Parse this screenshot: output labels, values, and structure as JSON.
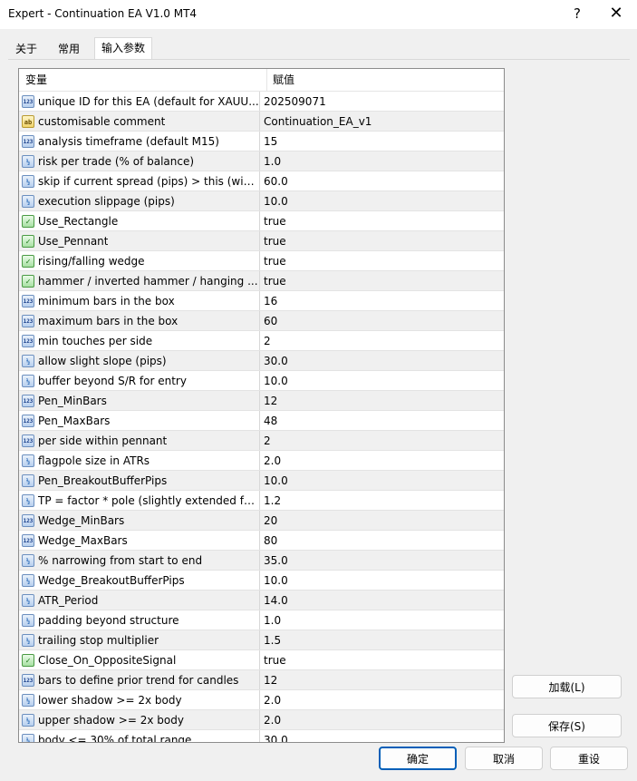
{
  "window": {
    "title": "Expert - Continuation EA V1.0 MT4",
    "help_glyph": "?",
    "close_glyph": "✕"
  },
  "tabs": [
    {
      "label": "关于"
    },
    {
      "label": "常用"
    },
    {
      "label": "输入参数"
    }
  ],
  "table": {
    "col_variable": "变量",
    "col_value": "赋值",
    "rows": [
      {
        "icon": "int",
        "name": "unique ID for this EA (default for XAUU...",
        "value": "202509071"
      },
      {
        "icon": "str",
        "name": "customisable comment",
        "value": "Continuation_EA_v1"
      },
      {
        "icon": "int",
        "name": "analysis timeframe (default M15)",
        "value": "15"
      },
      {
        "icon": "dbl",
        "name": "risk per trade (% of balance)",
        "value": "1.0"
      },
      {
        "icon": "dbl",
        "name": "skip if current spread (pips) > this (wid...",
        "value": "60.0"
      },
      {
        "icon": "dbl",
        "name": "execution slippage (pips)",
        "value": "10.0"
      },
      {
        "icon": "bool",
        "name": "Use_Rectangle",
        "value": "true"
      },
      {
        "icon": "bool",
        "name": "Use_Pennant",
        "value": "true"
      },
      {
        "icon": "bool",
        "name": "rising/falling wedge",
        "value": "true"
      },
      {
        "icon": "bool",
        "name": "hammer / inverted hammer / hanging ...",
        "value": "true"
      },
      {
        "icon": "int",
        "name": "minimum bars in the box",
        "value": "16"
      },
      {
        "icon": "int",
        "name": "maximum bars in the box",
        "value": "60"
      },
      {
        "icon": "int",
        "name": "min touches per side",
        "value": "2"
      },
      {
        "icon": "dbl",
        "name": "allow slight slope (pips)",
        "value": "30.0"
      },
      {
        "icon": "dbl",
        "name": "buffer beyond S/R for entry",
        "value": "10.0"
      },
      {
        "icon": "int",
        "name": "Pen_MinBars",
        "value": "12"
      },
      {
        "icon": "int",
        "name": "Pen_MaxBars",
        "value": "48"
      },
      {
        "icon": "int",
        "name": "per side within pennant",
        "value": "2"
      },
      {
        "icon": "dbl",
        "name": "flagpole size in ATRs",
        "value": "2.0"
      },
      {
        "icon": "dbl",
        "name": "Pen_BreakoutBufferPips",
        "value": "10.0"
      },
      {
        "icon": "dbl",
        "name": "TP = factor * pole (slightly extended for...",
        "value": "1.2"
      },
      {
        "icon": "int",
        "name": "Wedge_MinBars",
        "value": "20"
      },
      {
        "icon": "int",
        "name": "Wedge_MaxBars",
        "value": "80"
      },
      {
        "icon": "dbl",
        "name": "% narrowing from start to end",
        "value": "35.0"
      },
      {
        "icon": "dbl",
        "name": "Wedge_BreakoutBufferPips",
        "value": "10.0"
      },
      {
        "icon": "dbl",
        "name": "ATR_Period",
        "value": "14.0"
      },
      {
        "icon": "dbl",
        "name": "padding beyond structure",
        "value": "1.0"
      },
      {
        "icon": "dbl",
        "name": "trailing stop multiplier",
        "value": "1.5"
      },
      {
        "icon": "bool",
        "name": "Close_On_OppositeSignal",
        "value": "true"
      },
      {
        "icon": "int",
        "name": "bars to define prior trend for candles",
        "value": "12"
      },
      {
        "icon": "dbl",
        "name": "lower shadow >= 2x body",
        "value": "2.0"
      },
      {
        "icon": "dbl",
        "name": "upper shadow >= 2x body",
        "value": "2.0"
      },
      {
        "icon": "dbl",
        "name": "body <= 30% of total range",
        "value": "30.0"
      }
    ]
  },
  "side_buttons": {
    "load": "加载(L)",
    "save": "保存(S)"
  },
  "footer_buttons": {
    "ok": "确定",
    "cancel": "取消",
    "reset": "重设"
  }
}
